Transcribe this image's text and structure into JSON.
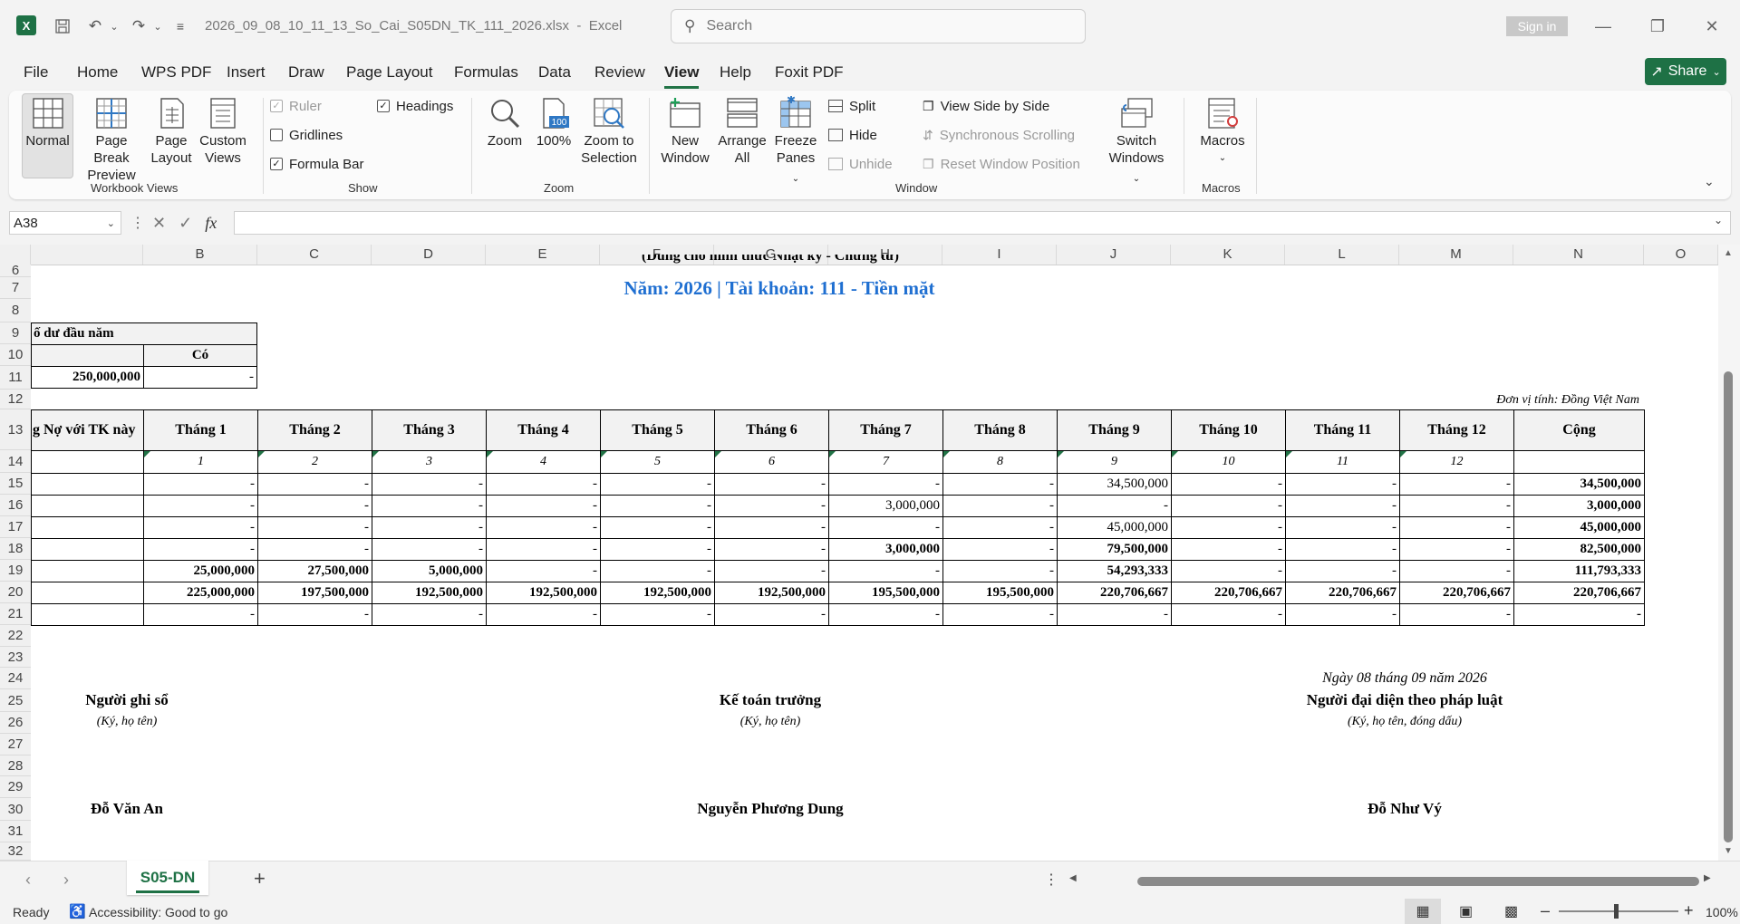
{
  "titlebar": {
    "filename": "2026_09_08_10_11_13_So_Cai_S05DN_TK_111_2026.xlsx",
    "separator": "-",
    "app": "Excel",
    "search_placeholder": "Search",
    "signin": "Sign in"
  },
  "menu": {
    "tabs": [
      "File",
      "Home",
      "WPS PDF",
      "Insert",
      "Draw",
      "Page Layout",
      "Formulas",
      "Data",
      "Review",
      "View",
      "Help",
      "Foxit PDF"
    ],
    "active": "View",
    "share": "Share"
  },
  "ribbon": {
    "workbook_views": {
      "label": "Workbook Views",
      "normal": "Normal",
      "page_break_1": "Page Break",
      "page_break_2": "Preview",
      "page_layout_1": "Page",
      "page_layout_2": "Layout",
      "custom_1": "Custom",
      "custom_2": "Views"
    },
    "show": {
      "label": "Show",
      "ruler": "Ruler",
      "gridlines": "Gridlines",
      "formula_bar": "Formula Bar",
      "headings": "Headings"
    },
    "zoom": {
      "label": "Zoom",
      "zoom": "Zoom",
      "hundred": "100%",
      "zoom_sel_1": "Zoom to",
      "zoom_sel_2": "Selection"
    },
    "window": {
      "label": "Window",
      "new_1": "New",
      "new_2": "Window",
      "arrange_1": "Arrange",
      "arrange_2": "All",
      "freeze_1": "Freeze",
      "freeze_2": "Panes",
      "split": "Split",
      "hide": "Hide",
      "unhide": "Unhide",
      "side_by_side": "View Side by Side",
      "sync_scroll": "Synchronous Scrolling",
      "reset_pos": "Reset Window Position",
      "switch_1": "Switch",
      "switch_2": "Windows"
    },
    "macros": {
      "label": "Macros",
      "macros": "Macros"
    }
  },
  "formula_bar": {
    "cell_ref": "A38",
    "value": ""
  },
  "columns": [
    "B",
    "C",
    "D",
    "E",
    "F",
    "G",
    "H",
    "I",
    "J",
    "K",
    "L",
    "M",
    "N",
    "O"
  ],
  "rows": [
    "6",
    "7",
    "8",
    "9",
    "10",
    "11",
    "12",
    "13",
    "14",
    "15",
    "16",
    "17",
    "18",
    "19",
    "20",
    "21",
    "22",
    "23",
    "24",
    "25",
    "26",
    "27",
    "28",
    "29",
    "30",
    "31",
    "32"
  ],
  "sheet": {
    "row6_partial": "(Dùng cho hình thức Nhật ký - Chứng từ)",
    "title_year": "Năm: 2026  |  Tài khoản: 111 - Tiền mặt",
    "opening_label": "ố dư đầu năm",
    "co_label": "Có",
    "opening_no": "250,000,000",
    "opening_co": "-",
    "unit": "Đơn vị tính: Đồng Việt Nam",
    "hdr_first": "g Nợ với TK này",
    "months": [
      "Tháng 1",
      "Tháng 2",
      "Tháng 3",
      "Tháng 4",
      "Tháng 5",
      "Tháng 6",
      "Tháng 7",
      "Tháng 8",
      "Tháng 9",
      "Tháng 10",
      "Tháng 11",
      "Tháng 12"
    ],
    "total_hdr": "Cộng",
    "month_nums": [
      "1",
      "2",
      "3",
      "4",
      "5",
      "6",
      "7",
      "8",
      "9",
      "10",
      "11",
      "12"
    ],
    "data_rows": [
      [
        "-",
        "-",
        "-",
        "-",
        "-",
        "-",
        "-",
        "-",
        "34,500,000",
        "-",
        "-",
        "-",
        "34,500,000"
      ],
      [
        "-",
        "-",
        "-",
        "-",
        "-",
        "-",
        "3,000,000",
        "-",
        "-",
        "-",
        "-",
        "-",
        "3,000,000"
      ],
      [
        "-",
        "-",
        "-",
        "-",
        "-",
        "-",
        "-",
        "-",
        "45,000,000",
        "-",
        "-",
        "-",
        "45,000,000"
      ],
      [
        "-",
        "-",
        "-",
        "-",
        "-",
        "-",
        "3,000,000",
        "-",
        "79,500,000",
        "-",
        "-",
        "-",
        "82,500,000"
      ],
      [
        "25,000,000",
        "27,500,000",
        "5,000,000",
        "-",
        "-",
        "-",
        "-",
        "-",
        "54,293,333",
        "-",
        "-",
        "-",
        "111,793,333"
      ],
      [
        "225,000,000",
        "197,500,000",
        "192,500,000",
        "192,500,000",
        "192,500,000",
        "192,500,000",
        "195,500,000",
        "195,500,000",
        "220,706,667",
        "220,706,667",
        "220,706,667",
        "220,706,667",
        "220,706,667"
      ],
      [
        "-",
        "-",
        "-",
        "-",
        "-",
        "-",
        "-",
        "-",
        "-",
        "-",
        "-",
        "-",
        "-"
      ]
    ],
    "date_line": "Ngày 08 tháng 09 năm 2026",
    "sign1_title": "Người ghi sổ",
    "sign1_note": "(Ký, họ tên)",
    "sign1_name": "Đỗ Văn An",
    "sign2_title": "Kế toán trưởng",
    "sign2_note": "(Ký, họ tên)",
    "sign2_name": "Nguyễn Phương Dung",
    "sign3_title": "Người đại diện theo pháp luật",
    "sign3_note": "(Ký, họ tên, đóng dấu)",
    "sign3_name": "Đỗ Như Vý"
  },
  "sheet_tabs": {
    "active": "S05-DN"
  },
  "status": {
    "ready": "Ready",
    "accessibility": "Accessibility: Good to go",
    "zoom": "100%"
  },
  "colors": {
    "accent": "#217346",
    "title_blue": "#1f6fd1"
  }
}
